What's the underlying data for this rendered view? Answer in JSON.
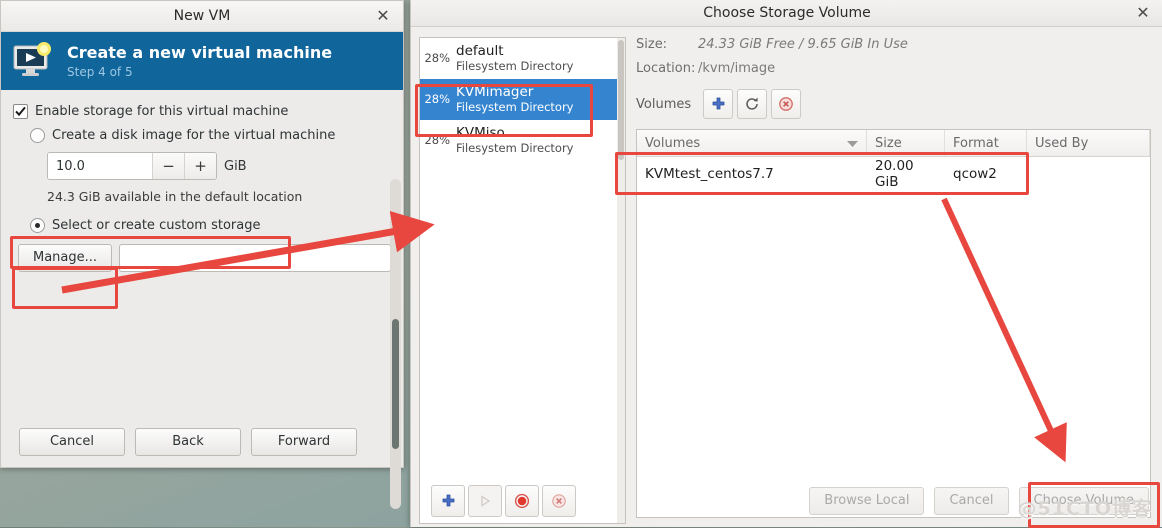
{
  "newvm": {
    "window_title": "New VM",
    "close_icon": "close-icon",
    "header_title": "Create a new virtual machine",
    "header_step": "Step 4 of 5",
    "enable_storage_label": "Enable storage for this virtual machine",
    "enable_storage_checked": true,
    "create_disk_label": "Create a disk image for the virtual machine",
    "create_disk_selected": false,
    "disk_size_value": "10.0",
    "disk_size_unit": "GiB",
    "spin_minus": "−",
    "spin_plus": "+",
    "available_hint": "24.3 GiB available in the default location",
    "custom_storage_label": "Select or create custom storage",
    "custom_storage_selected": true,
    "manage_button": "Manage...",
    "path_value": "",
    "path_placeholder": "",
    "buttons": {
      "cancel": "Cancel",
      "back": "Back",
      "forward": "Forward"
    }
  },
  "storage": {
    "window_title": "Choose Storage Volume",
    "close_icon": "close-icon",
    "pools": [
      {
        "percent": "28%",
        "name": "default",
        "type": "Filesystem Directory",
        "selected": false
      },
      {
        "percent": "28%",
        "name": "KVMimager",
        "type": "Filesystem Directory",
        "selected": true
      },
      {
        "percent": "28%",
        "name": "KVMiso",
        "type": "Filesystem Directory",
        "selected": false
      }
    ],
    "detail": {
      "size_label": "Size:",
      "size_value": "24.33 GiB Free / 9.65 GiB In Use",
      "location_label": "Location:",
      "location_value": "/kvm/image"
    },
    "volumes_label": "Volumes",
    "volume_toolbar": [
      {
        "icon": "add-volume-icon",
        "enabled": true
      },
      {
        "icon": "refresh-volume-icon",
        "enabled": true
      },
      {
        "icon": "delete-volume-icon",
        "enabled": true
      }
    ],
    "table": {
      "columns": [
        "Volumes",
        "Size",
        "Format",
        "Used By"
      ],
      "sort_icon": "chevron-down-icon",
      "rows": [
        {
          "name": "KVMtest_centos7.7",
          "size": "20.00 GiB",
          "format": "qcow2",
          "used_by": ""
        }
      ]
    },
    "pool_actions": [
      {
        "icon": "add-pool-icon",
        "enabled": true
      },
      {
        "icon": "start-pool-icon",
        "enabled": false
      },
      {
        "icon": "stop-pool-icon",
        "enabled": true
      },
      {
        "icon": "delete-pool-icon",
        "enabled": true
      }
    ],
    "buttons": {
      "browse_local": "Browse Local",
      "cancel": "Cancel",
      "choose_volume": "Choose Volume",
      "choose_volume_enabled": false
    }
  },
  "annotations": {
    "accent_color": "#e8473f",
    "watermark": "@51CTO博客"
  }
}
